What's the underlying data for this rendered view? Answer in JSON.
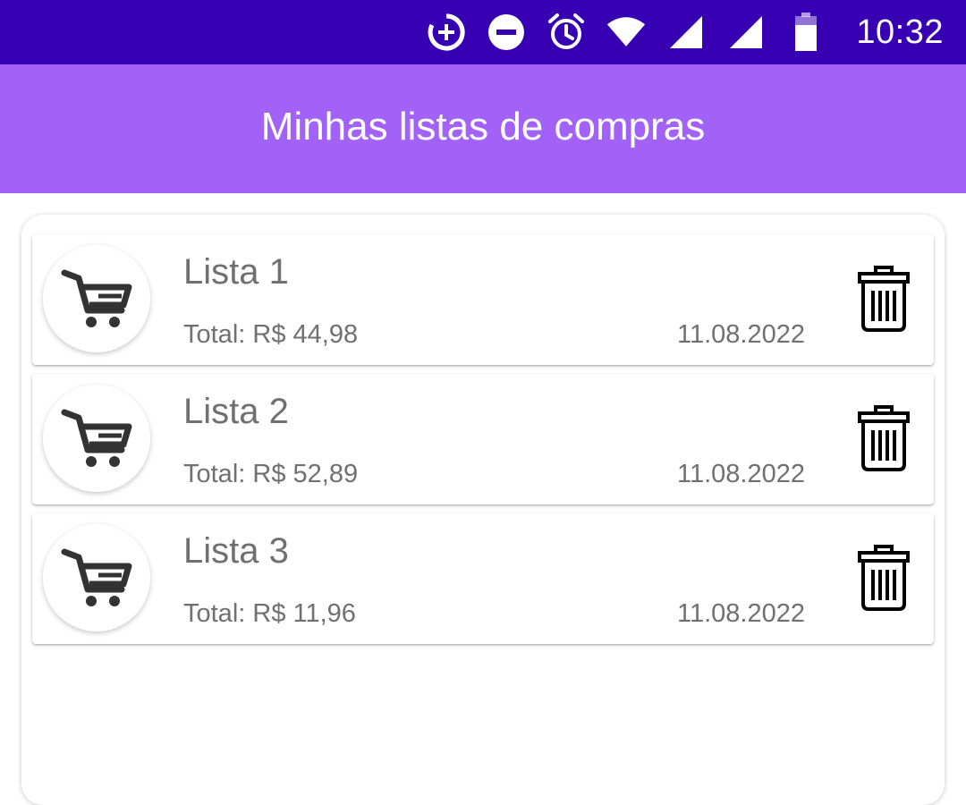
{
  "status_bar": {
    "time": "10:32",
    "icons": [
      "data-saver-icon",
      "do-not-disturb-icon",
      "alarm-icon",
      "wifi-icon",
      "signal-icon",
      "signal-icon",
      "battery-icon"
    ]
  },
  "app_bar": {
    "title": "Minhas listas de compras"
  },
  "lists": [
    {
      "name": "Lista 1",
      "total": "Total: R$ 44,98",
      "date": "11.08.2022"
    },
    {
      "name": "Lista 2",
      "total": "Total: R$ 52,89",
      "date": "11.08.2022"
    },
    {
      "name": "Lista 3",
      "total": "Total: R$ 11,96",
      "date": "11.08.2022"
    }
  ],
  "colors": {
    "status_bar": "#3700b3",
    "app_bar": "#a362f7",
    "text_secondary": "#707070",
    "icon_dark": "#333333"
  }
}
